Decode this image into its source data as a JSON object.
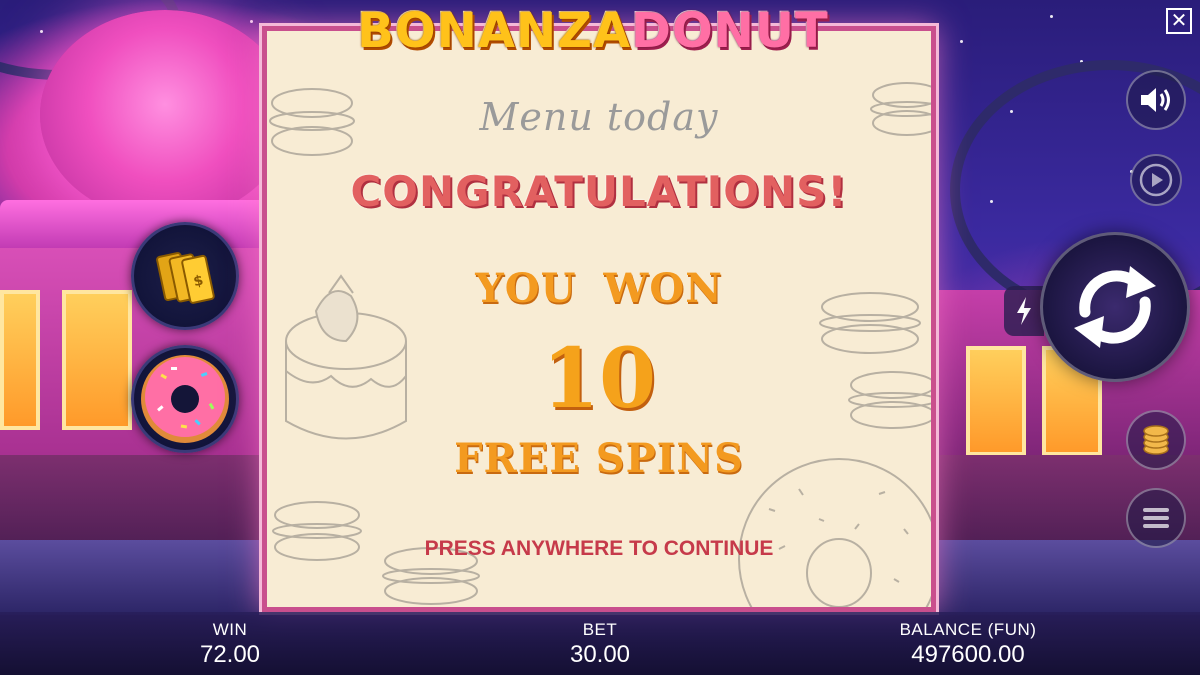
{
  "game": {
    "logo_word1": "BONANZA",
    "logo_word2": "DONUT"
  },
  "popup": {
    "header": "Menu today",
    "title": "CONGRATULATIONS!",
    "won_label": "YOU  WON",
    "won_amount": "10",
    "won_unit": "FREE SPINS",
    "instruction": "PRESS ANYWHERE TO CONTINUE"
  },
  "status": {
    "win_label": "WIN",
    "win_value": "72.00",
    "bet_label": "BET",
    "bet_value": "30.00",
    "balance_label": "BALANCE (FUN)",
    "balance_value": "497600.00"
  },
  "controls": {
    "close_glyph": "✕",
    "icons": [
      "speaker-icon",
      "autoplay-icon",
      "spin-icon",
      "turbo-icon",
      "coins-icon",
      "menu-icon",
      "tickets-icon",
      "donut-icon"
    ]
  },
  "colors": {
    "popup_bg": "#f8ecd4",
    "popup_border": "#c94f8d",
    "title": "#e26060",
    "accent_orange": "#f39a20",
    "instruction": "#c63a4a"
  }
}
